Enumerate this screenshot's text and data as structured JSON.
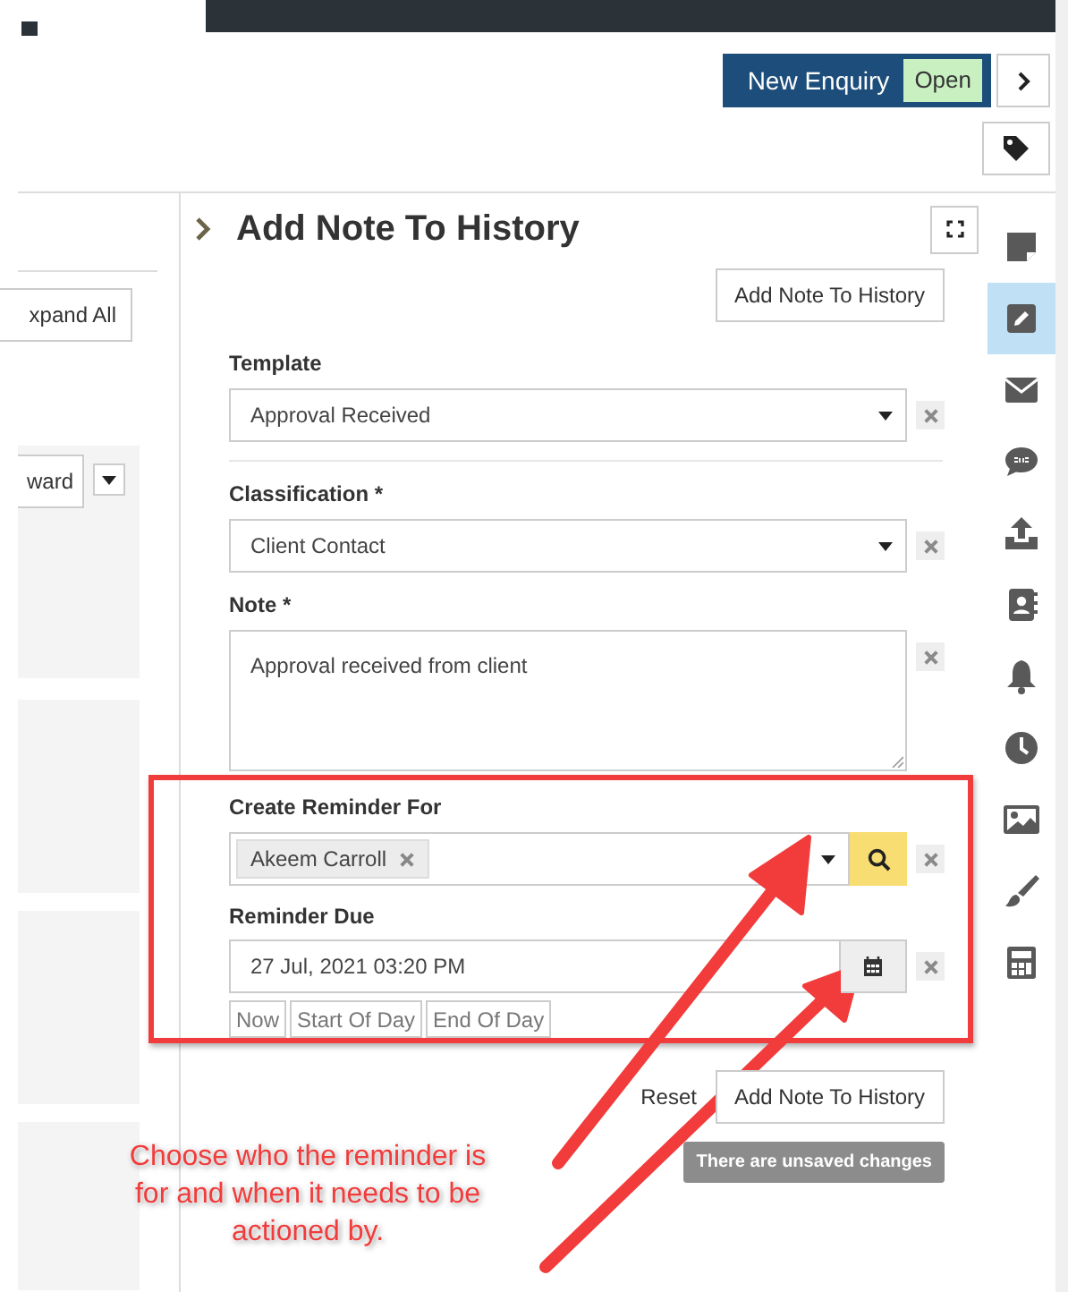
{
  "header": {
    "enquiry_title": "New Enquiry",
    "status": "Open"
  },
  "left_panel": {
    "expand_button": "xpand All",
    "action_button": "ward"
  },
  "panel": {
    "title": "Add Note To History",
    "submit_top": "Add Note To History",
    "fields": [
      {
        "kind": "select",
        "label": "Template",
        "value": "Approval Received"
      },
      {
        "kind": "select",
        "label": "Classification *",
        "value": "Client Contact"
      },
      {
        "kind": "textarea",
        "label": "Note *",
        "value": "Approval received from client"
      }
    ],
    "reminder": {
      "for_label": "Create Reminder For",
      "recipients": [
        "Akeem Carroll"
      ],
      "due_label": "Reminder Due",
      "due_value": "27 Jul, 2021 03:20 PM",
      "quick_buttons": [
        "Now",
        "Start Of Day",
        "End Of Day"
      ]
    },
    "reset": "Reset",
    "submit": "Add Note To History",
    "unsaved_notice": "There are unsaved changes"
  },
  "side_icons": [
    {
      "kind": "note",
      "selected": false
    },
    {
      "kind": "pencil",
      "selected": true
    },
    {
      "kind": "envelope",
      "selected": false
    },
    {
      "kind": "sms",
      "selected": false
    },
    {
      "kind": "upload",
      "selected": false
    },
    {
      "kind": "contact",
      "selected": false
    },
    {
      "kind": "bell",
      "selected": false
    },
    {
      "kind": "clock",
      "selected": false
    },
    {
      "kind": "image",
      "selected": false
    },
    {
      "kind": "brush",
      "selected": false
    },
    {
      "kind": "calculator",
      "selected": false
    }
  ],
  "annotation": {
    "text": "Choose who the reminder is for and when it needs to be actioned by."
  }
}
